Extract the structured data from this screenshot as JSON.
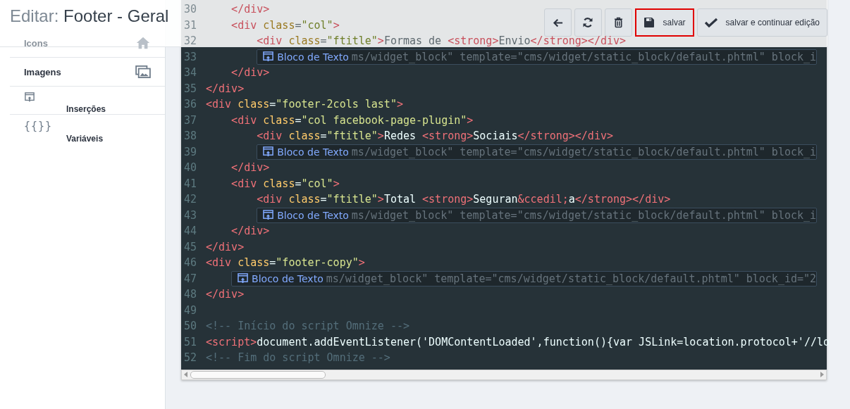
{
  "header": {
    "title_prefix": "Editar:",
    "title_name": "Footer - Geral",
    "buttons": [
      {
        "kind": "icon"
      },
      {
        "kind": "icon"
      },
      {
        "kind": "icon"
      },
      {
        "kind": "text",
        "label": "salvar",
        "highlighted": true
      },
      {
        "kind": "text",
        "label": "salvar e continuar edição",
        "highlighted": false
      }
    ]
  },
  "sidebar": {
    "items": [
      {
        "kind": "row",
        "label": "Icons",
        "dimmed": true
      },
      {
        "kind": "row",
        "label": "Imagens"
      },
      {
        "kind": "stacked",
        "label": "Inserções"
      },
      {
        "kind": "stacked",
        "label": "Variáveis",
        "icon_text": "{{}}"
      }
    ]
  },
  "editor": {
    "lines": [
      {
        "number": "30",
        "dimmed": true,
        "tokens": [
          {
            "kind": "tag",
            "text": "    </div>"
          }
        ]
      },
      {
        "number": "31",
        "dimmed": true,
        "tokens": [
          {
            "kind": "tag",
            "text": "    <div"
          },
          {
            "kind": "attr",
            "text": " class"
          },
          {
            "kind": "txt",
            "text": "="
          },
          {
            "kind": "str",
            "text": "\"col\""
          },
          {
            "kind": "tag",
            "text": ">"
          }
        ]
      },
      {
        "number": "32",
        "dimmed": true,
        "tokens": [
          {
            "kind": "tag",
            "text": "        <div"
          },
          {
            "kind": "attr",
            "text": " class"
          },
          {
            "kind": "txt",
            "text": "="
          },
          {
            "kind": "str",
            "text": "\"ftitle\""
          },
          {
            "kind": "tag",
            "text": ">"
          },
          {
            "kind": "txt",
            "text": "Formas de "
          },
          {
            "kind": "tag",
            "text": "<strong>"
          },
          {
            "kind": "txt",
            "text": "Envio"
          },
          {
            "kind": "tag",
            "text": "</strong></div>"
          }
        ]
      },
      {
        "number": "33",
        "widget": {
          "label": "Bloco de Texto",
          "rest": "ms/widget_block\" template=\"cms/widget/static_block/default.phtml\" block_i"
        }
      },
      {
        "number": "34",
        "tokens": [
          {
            "kind": "tag",
            "text": "    </div>"
          }
        ]
      },
      {
        "number": "35",
        "tokens": [
          {
            "kind": "tag",
            "text": "</div>"
          }
        ]
      },
      {
        "number": "36",
        "tokens": [
          {
            "kind": "tag",
            "text": "<div"
          },
          {
            "kind": "attr",
            "text": " class"
          },
          {
            "kind": "txt",
            "text": "="
          },
          {
            "kind": "str",
            "text": "\"footer-2cols last\""
          },
          {
            "kind": "tag",
            "text": ">"
          }
        ]
      },
      {
        "number": "37",
        "tokens": [
          {
            "kind": "tag",
            "text": "    <div"
          },
          {
            "kind": "attr",
            "text": " class"
          },
          {
            "kind": "txt",
            "text": "="
          },
          {
            "kind": "str",
            "text": "\"col facebook-page-plugin\""
          },
          {
            "kind": "tag",
            "text": ">"
          }
        ]
      },
      {
        "number": "38",
        "tokens": [
          {
            "kind": "tag",
            "text": "        <div"
          },
          {
            "kind": "attr",
            "text": " class"
          },
          {
            "kind": "txt",
            "text": "="
          },
          {
            "kind": "str",
            "text": "\"ftitle\""
          },
          {
            "kind": "tag",
            "text": ">"
          },
          {
            "kind": "txt",
            "text": "Redes "
          },
          {
            "kind": "tag",
            "text": "<strong>"
          },
          {
            "kind": "txt",
            "text": "Sociais"
          },
          {
            "kind": "tag",
            "text": "</strong></div>"
          }
        ]
      },
      {
        "number": "39",
        "widget": {
          "label": "Bloco de Texto",
          "rest": "ms/widget_block\" template=\"cms/widget/static_block/default.phtml\" block_i"
        }
      },
      {
        "number": "40",
        "tokens": [
          {
            "kind": "tag",
            "text": "    </div>"
          }
        ]
      },
      {
        "number": "41",
        "tokens": [
          {
            "kind": "tag",
            "text": "    <div"
          },
          {
            "kind": "attr",
            "text": " class"
          },
          {
            "kind": "txt",
            "text": "="
          },
          {
            "kind": "str",
            "text": "\"col\""
          },
          {
            "kind": "tag",
            "text": ">"
          }
        ]
      },
      {
        "number": "42",
        "tokens": [
          {
            "kind": "tag",
            "text": "        <div"
          },
          {
            "kind": "attr",
            "text": " class"
          },
          {
            "kind": "txt",
            "text": "="
          },
          {
            "kind": "str",
            "text": "\"ftitle\""
          },
          {
            "kind": "tag",
            "text": ">"
          },
          {
            "kind": "txt",
            "text": "Total "
          },
          {
            "kind": "tag",
            "text": "<strong>"
          },
          {
            "kind": "txt",
            "text": "Seguran"
          },
          {
            "kind": "ent",
            "text": "&ccedil;"
          },
          {
            "kind": "txt",
            "text": "a"
          },
          {
            "kind": "tag",
            "text": "</strong></div>"
          }
        ]
      },
      {
        "number": "43",
        "widget": {
          "label": "Bloco de Texto",
          "rest": "ms/widget_block\" template=\"cms/widget/static_block/default.phtml\" block_i"
        }
      },
      {
        "number": "44",
        "tokens": [
          {
            "kind": "tag",
            "text": "    </div>"
          }
        ]
      },
      {
        "number": "45",
        "tokens": [
          {
            "kind": "tag",
            "text": "</div>"
          }
        ]
      },
      {
        "number": "46",
        "tokens": [
          {
            "kind": "tag",
            "text": "<div"
          },
          {
            "kind": "attr",
            "text": " class"
          },
          {
            "kind": "txt",
            "text": "="
          },
          {
            "kind": "str",
            "text": "\"footer-copy\""
          },
          {
            "kind": "tag",
            "text": ">"
          }
        ]
      },
      {
        "number": "47",
        "widget": {
          "label": "Bloco de Texto",
          "rest": "ms/widget_block\" template=\"cms/widget/static_block/default.phtml\" block_id=\"2"
        }
      },
      {
        "number": "48",
        "tokens": [
          {
            "kind": "tag",
            "text": "</div>"
          }
        ]
      },
      {
        "number": "49"
      },
      {
        "number": "50",
        "tokens": [
          {
            "kind": "cmt",
            "text": "<!-- Início do script Omnize -->"
          }
        ]
      },
      {
        "number": "51",
        "tokens": [
          {
            "kind": "tag",
            "text": "<script>"
          },
          {
            "kind": "txt",
            "text": "document.addEventListener('DOMContentLoaded',function(){var JSLink=location.protocol+'//lo"
          }
        ]
      },
      {
        "number": "52",
        "tokens": [
          {
            "kind": "cmt",
            "text": "<!-- Fim do script Omnize -->"
          }
        ]
      }
    ]
  }
}
